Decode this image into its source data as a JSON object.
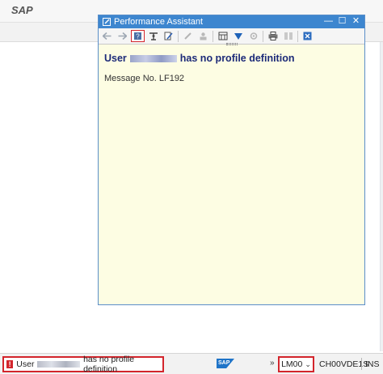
{
  "app": {
    "title": "SAP"
  },
  "popup": {
    "title": "Performance Assistant",
    "controls": {
      "minimize": "—",
      "maximize": "☐",
      "close": "✕"
    },
    "toolbar_icons": [
      "back-icon",
      "forward-icon",
      "help-book-icon",
      "technical-info-icon",
      "edit-icon",
      "edit-pen-icon",
      "user-icon",
      "calendar-icon",
      "bookmark-icon",
      "settings-icon",
      "print-icon",
      "doc-icon",
      "close-icon"
    ],
    "heading": {
      "prefix": "User",
      "suffix": "has no profile definition"
    },
    "message_number": "Message No. LF192"
  },
  "status_bar": {
    "message": {
      "prefix": "User",
      "suffix": "has no profile definition"
    },
    "logo": "SAP",
    "more": "»",
    "system": "LM00",
    "server": "CH00VDE1S",
    "mode": "INS"
  },
  "colors": {
    "titlebar": "#3d86cf",
    "popup_background": "#fdfde3",
    "heading_text": "#1c2a78",
    "highlight": "#d3252c"
  }
}
